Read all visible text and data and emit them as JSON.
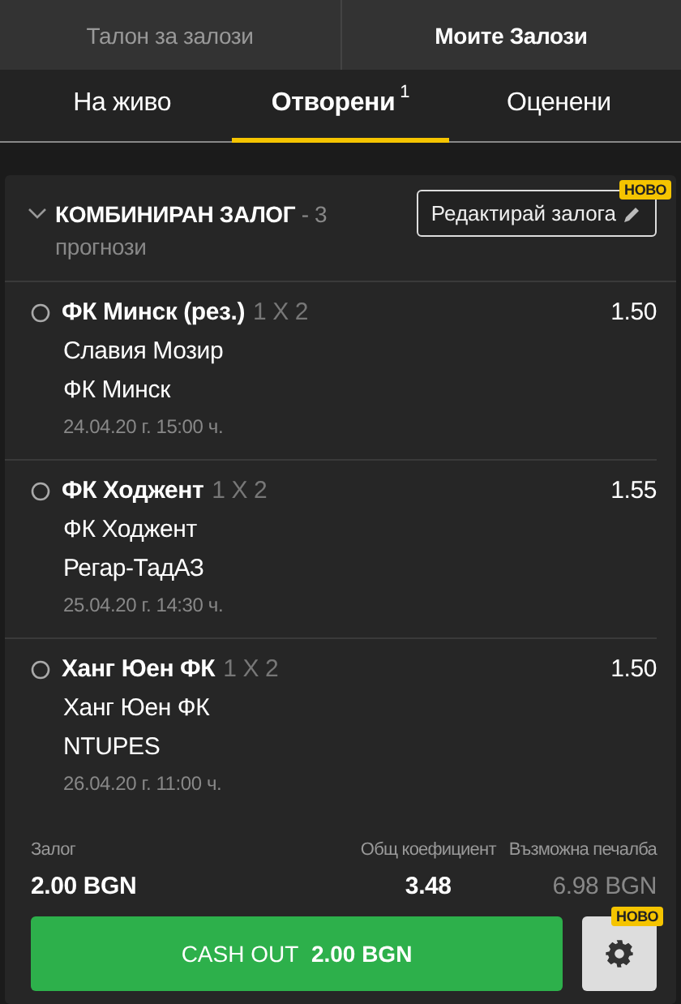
{
  "top_tabs": [
    {
      "label": "Талон за залози",
      "selected": false
    },
    {
      "label": "Моите Залози",
      "selected": true
    }
  ],
  "sub_tabs": [
    {
      "label": "На живо",
      "selected": false
    },
    {
      "label": "Отворени",
      "count": "1",
      "selected": true
    },
    {
      "label": "Оценени",
      "selected": false
    }
  ],
  "bet": {
    "title": "КОМБИНИРАН ЗАЛОГ",
    "subtitle": "- 3 прогнози",
    "edit_button": {
      "label": "Редактирай залога",
      "badge": "НОВО"
    },
    "selections": [
      {
        "pick": "ФК Минск (рез.)",
        "market": "1 X 2",
        "odds": "1.50",
        "home": "Славия Мозир",
        "away": "ФК Минск",
        "date": "24.04.20 г. 15:00 ч."
      },
      {
        "pick": "ФК Ходжент",
        "market": "1 X 2",
        "odds": "1.55",
        "home": "ФК Ходжент",
        "away": "Регар-ТадАЗ",
        "date": "25.04.20 г. 14:30 ч."
      },
      {
        "pick": "Ханг Юен ФК",
        "market": "1 X 2",
        "odds": "1.50",
        "home": "Ханг Юен ФК",
        "away": "NTUPES",
        "date": "26.04.20 г. 11:00 ч."
      }
    ],
    "summary": [
      {
        "label": "Залог",
        "value": "2.00 BGN",
        "kind": "stake"
      },
      {
        "label": "Общ коефициент",
        "value": "3.48",
        "kind": "odds"
      },
      {
        "label": "Възможна печалба",
        "value": "6.98 BGN",
        "kind": "win"
      }
    ],
    "cash_out": {
      "label": "CASH OUT",
      "amount": "2.00 BGN"
    },
    "settings_badge": "НОВО"
  }
}
